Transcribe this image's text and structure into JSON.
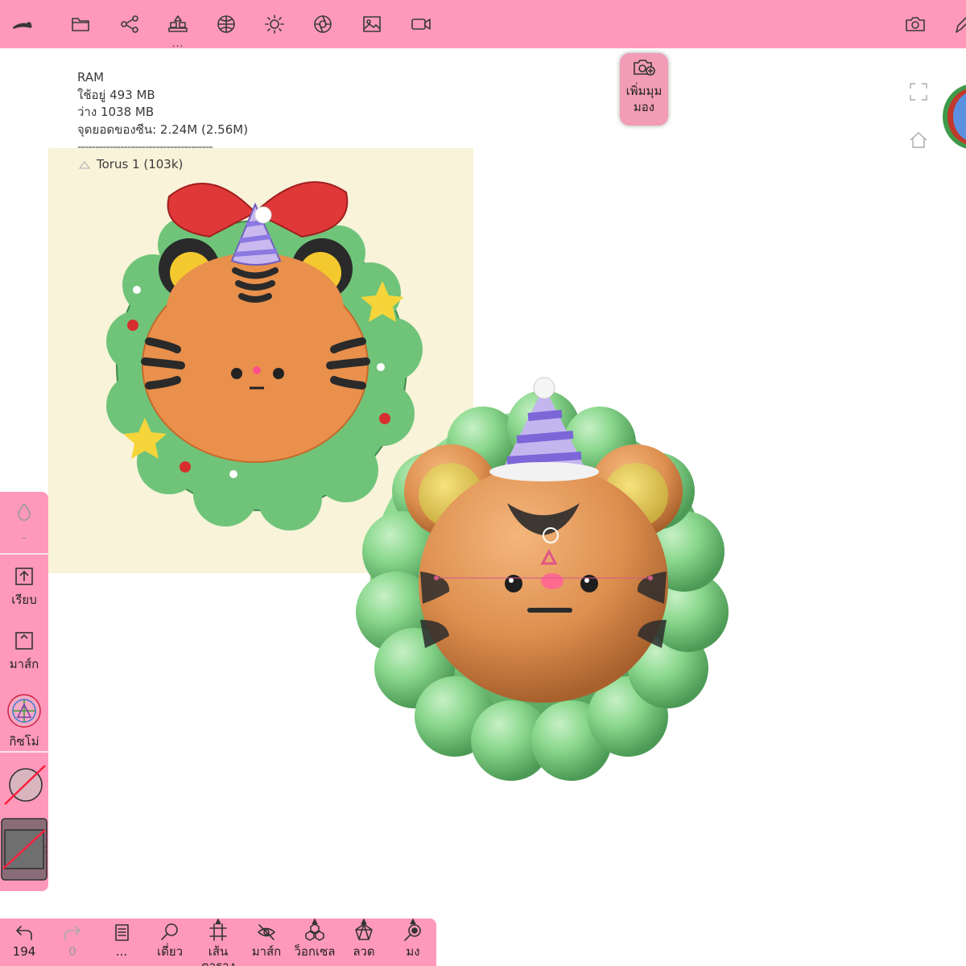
{
  "toolbar": {
    "icons": [
      "eyedropper-tray-icon",
      "folder-icon",
      "share-icon",
      "shapes-icon",
      "sphere-icon",
      "light-icon",
      "camera-lens-icon",
      "image-icon",
      "video-icon",
      "camera-icon",
      "pen-icon"
    ],
    "more": "..."
  },
  "stats": {
    "ram": "RAM",
    "used": "ใช้อยู่ 493 MB",
    "free": "ว่าง 1038 MB",
    "vertices": "จุดยอดของซีน: 2.24M (2.56M)",
    "separator": "--------------------------------------",
    "mesh": "Torus 1 (103k)"
  },
  "add_view": {
    "label": "เพิ่มมุมมอง"
  },
  "left_panel": {
    "arrange": "เรียบ",
    "mask": "มาส์ก",
    "gizmo": "กิซโม่",
    "dash": "-"
  },
  "bottom": {
    "undo_count": "194",
    "redo_count": "0",
    "more": "...",
    "solo": "เดี่ยว",
    "grid": "เส้นตาราง",
    "mask": "มาส์ก",
    "voxel": "ว็อกเซล",
    "wire": "ลวด",
    "view": "มง"
  },
  "colors": {
    "bar": "#ff99bb",
    "reference_bg": "#f8f3d9",
    "wreath": "#7fcf86",
    "tiger": "#e89a4e"
  }
}
